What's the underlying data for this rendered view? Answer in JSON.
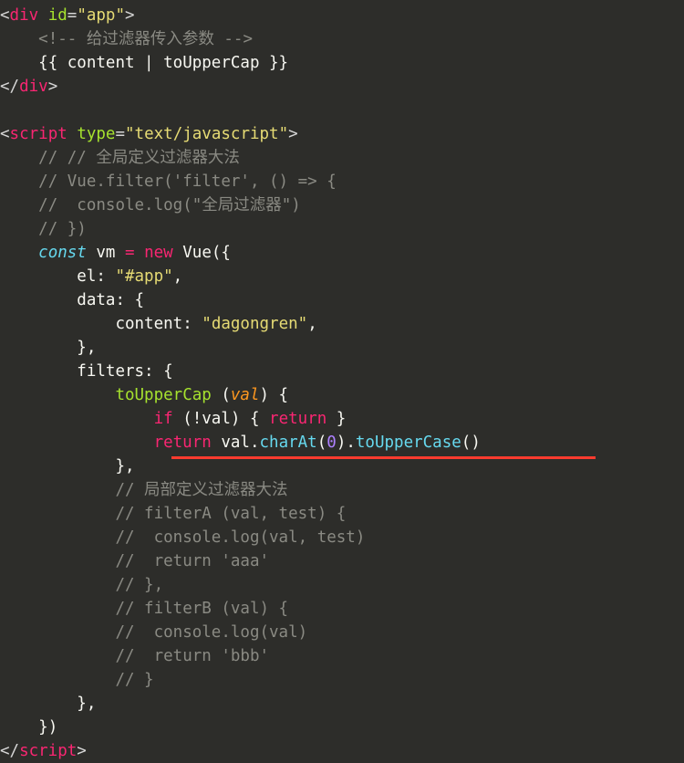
{
  "lines": {
    "l1_tag_open": "div",
    "l1_attr": "id",
    "l1_val": "\"app\"",
    "l2_comment": "<!-- 给过滤器传入参数 -->",
    "l3_text": "{{ content | toUpperCap }}",
    "l4_tag_close": "div",
    "l5_tag": "script",
    "l5_attr": "type",
    "l5_val": "\"text/javascript\"",
    "c1": "// // 全局定义过滤器大法",
    "c2": "// Vue.filter('filter', () => {",
    "c3": "//  console.log(\"全局过滤器\")",
    "c4": "// })",
    "const_kw": "const",
    "vm": "vm",
    "eq": "=",
    "new_kw": "new",
    "vue": "Vue",
    "el_key": "el:",
    "el_val": "\"#app\"",
    "data_key": "data:",
    "content_key": "content:",
    "content_val": "\"dagongren\"",
    "filters_key": "filters:",
    "fn_name": "toUpperCap",
    "fn_param": "val",
    "if_kw": "if",
    "not_val": "!val",
    "return_kw": "return",
    "return2": "return",
    "val_ref": "val",
    "charAt": "charAt",
    "zero": "0",
    "toUpper": "toUpperCase",
    "cc1": "// 局部定义过滤器大法",
    "cc2": "// filterA (val, test) {",
    "cc3": "//  console.log(val, test)",
    "cc4": "//  return 'aaa'",
    "cc5": "// },",
    "cc6": "// filterB (val) {",
    "cc7": "//  console.log(val)",
    "cc8": "//  return 'bbb'",
    "cc9": "// }",
    "script_close": "script"
  }
}
